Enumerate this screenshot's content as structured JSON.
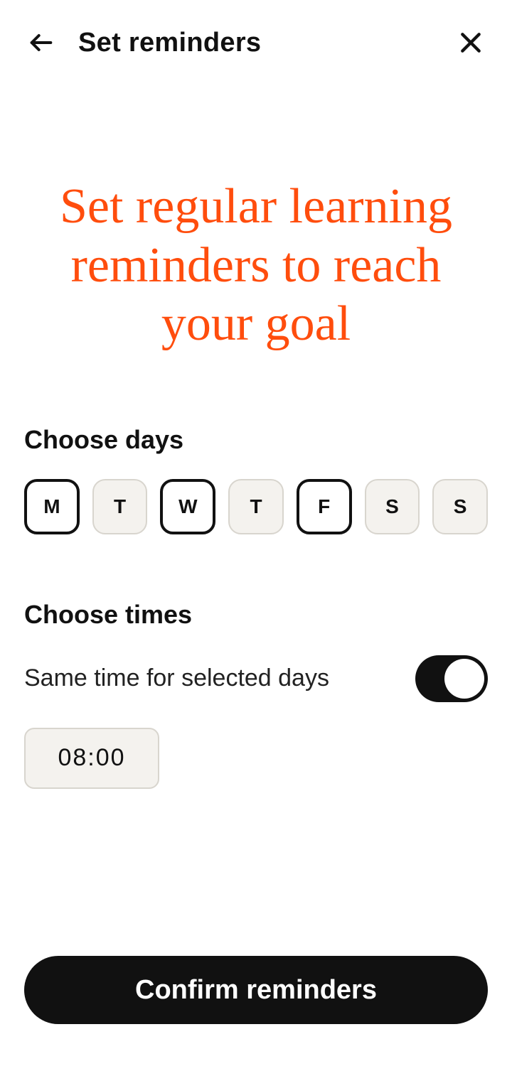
{
  "header": {
    "title": "Set reminders"
  },
  "headline": "Set regular learning reminders to reach your goal",
  "days": {
    "label": "Choose days",
    "items": [
      {
        "letter": "M",
        "selected": true
      },
      {
        "letter": "T",
        "selected": false
      },
      {
        "letter": "W",
        "selected": true
      },
      {
        "letter": "T",
        "selected": false
      },
      {
        "letter": "F",
        "selected": true
      },
      {
        "letter": "S",
        "selected": false
      },
      {
        "letter": "S",
        "selected": false
      }
    ]
  },
  "times": {
    "label": "Choose times",
    "same_time_label": "Same time for selected days",
    "same_time_on": true,
    "time_value": "08:00"
  },
  "confirm_label": "Confirm reminders",
  "colors": {
    "accent": "#ff4d0d",
    "chip_bg": "#f4f2ee",
    "chip_border": "#d8d5ce",
    "ink": "#111111"
  }
}
